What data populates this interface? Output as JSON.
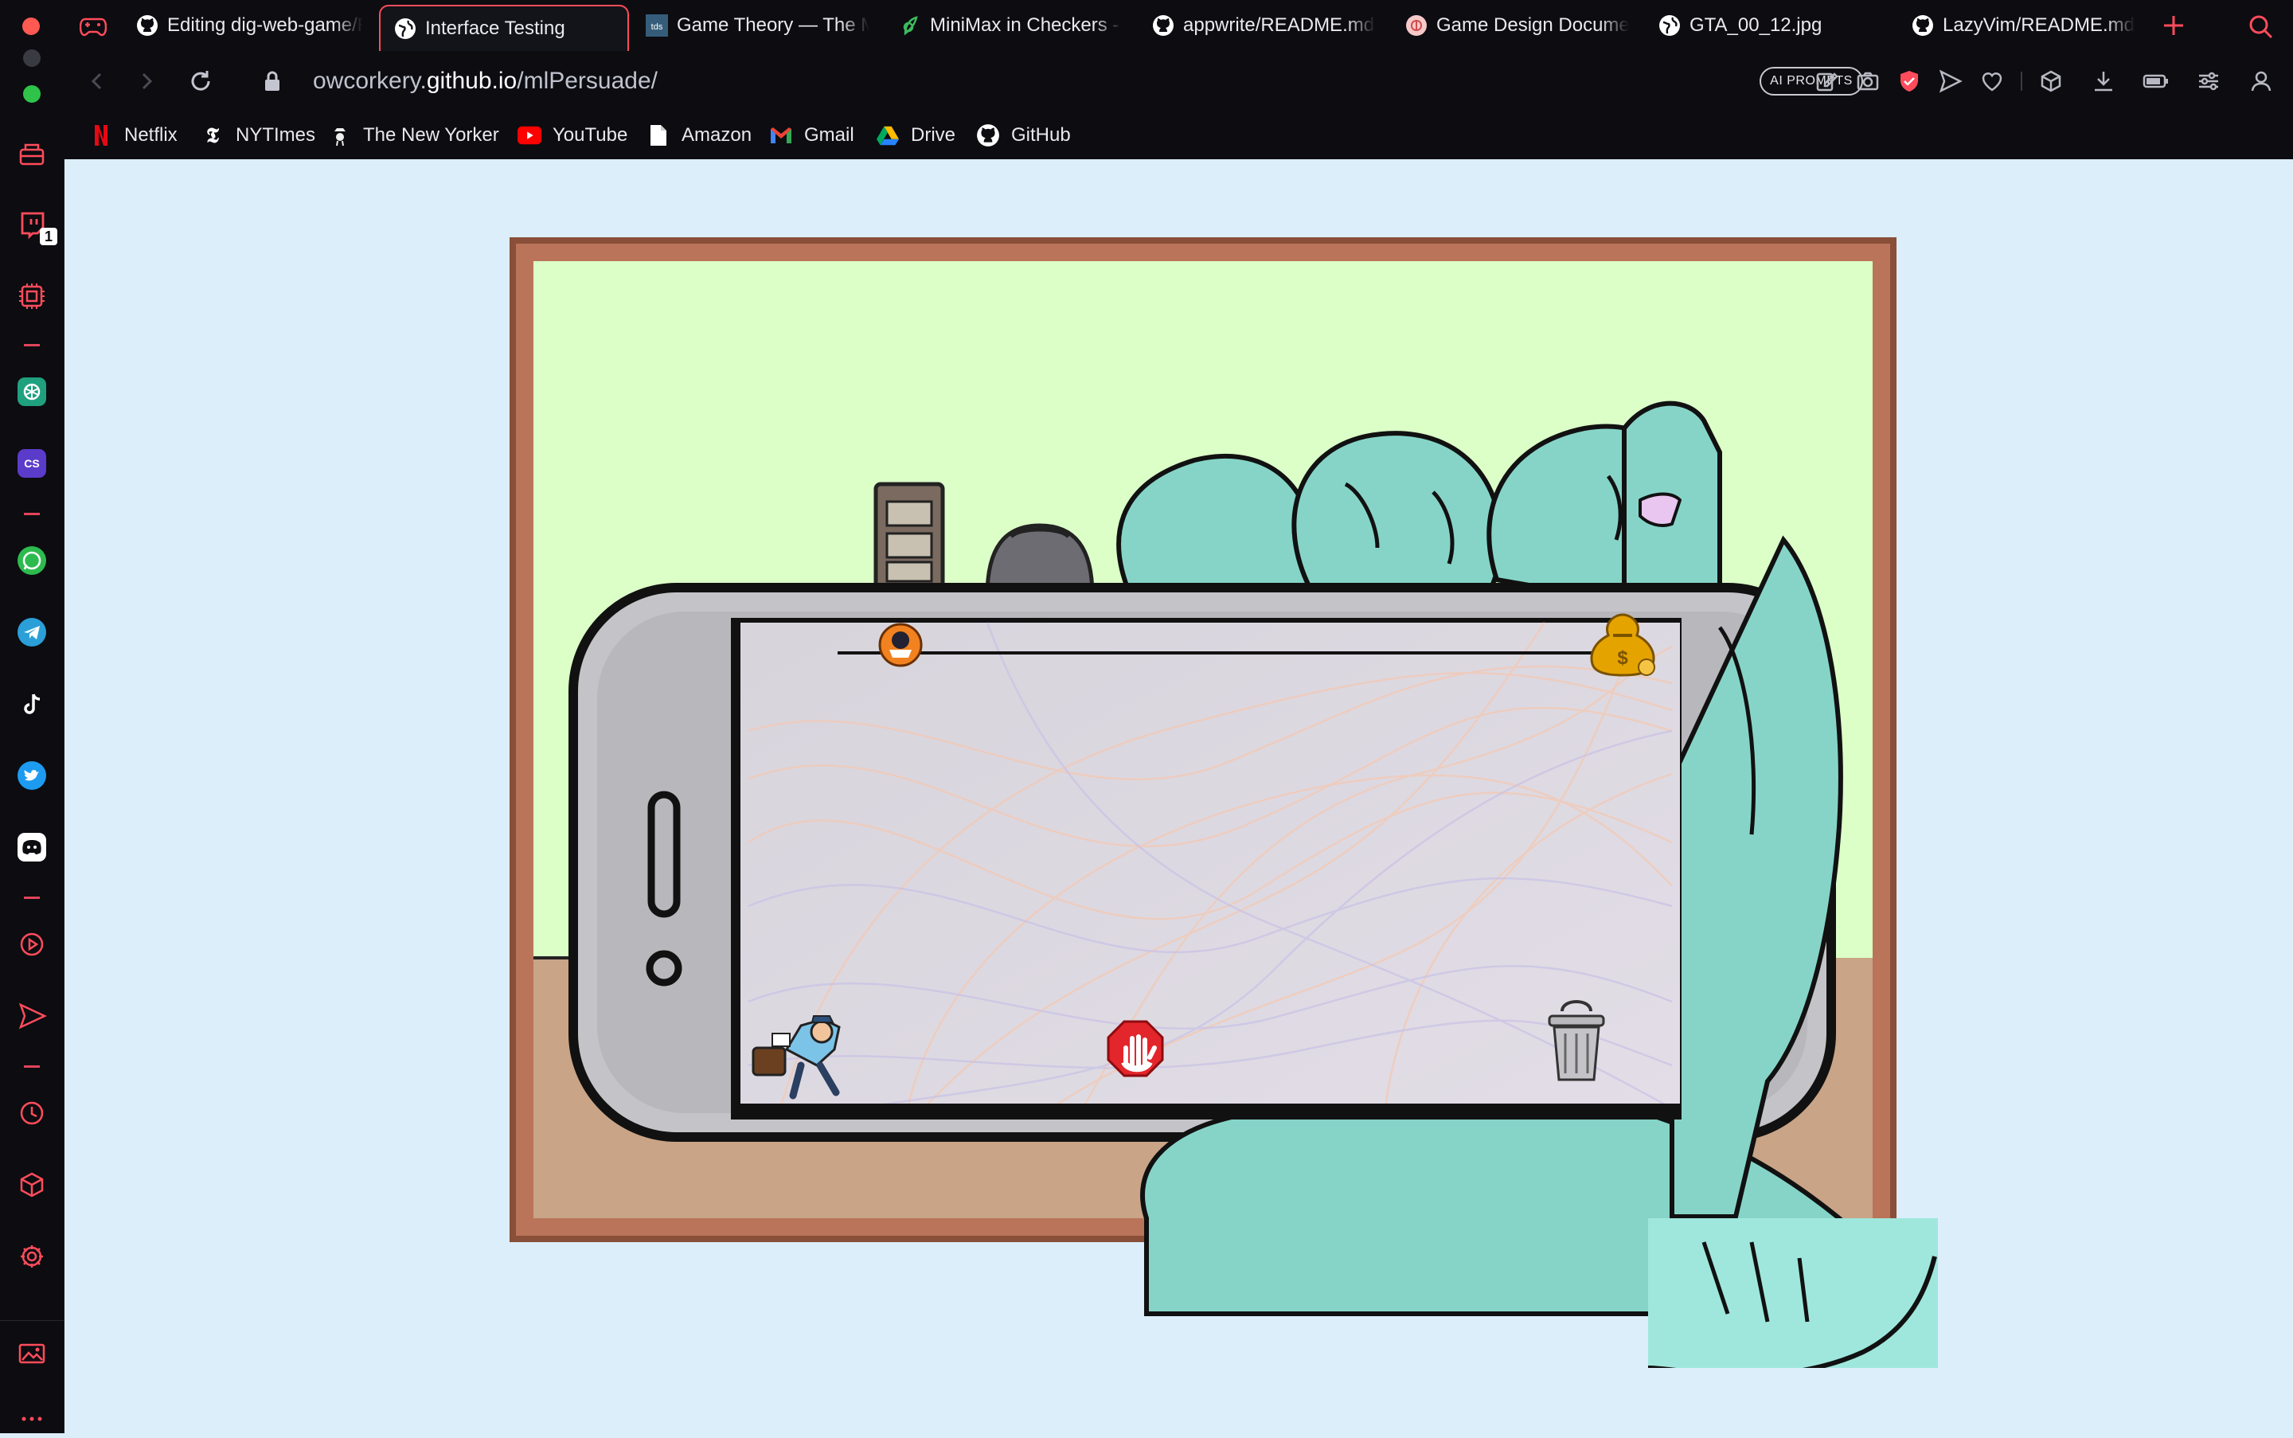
{
  "browser": {
    "tabs": [
      {
        "label": "Editing dig-web-game/README.md",
        "icon": "github-icon"
      },
      {
        "label": "Interface Testing",
        "icon": "globe-icon",
        "active": true
      },
      {
        "label": "Game Theory — The Minimax Algorithm",
        "icon": "tds-icon"
      },
      {
        "label": "MiniMax in Checkers - GeeksforGeeks",
        "icon": "leaf-icon"
      },
      {
        "label": "appwrite/README.md at master",
        "icon": "github-icon"
      },
      {
        "label": "Game Design Document",
        "icon": "brain-icon"
      },
      {
        "label": "GTA_00_12.jpg",
        "icon": "globe-icon"
      },
      {
        "label": "LazyVim/README.md at main",
        "icon": "github-icon"
      }
    ],
    "url": {
      "host_prefix": "owcorkery.",
      "host_main": "github.io",
      "path": "/mlPersuade/"
    },
    "ai_prompts_label": "AI PROMPTS",
    "bookmarks": [
      {
        "label": "Netflix",
        "icon": "netflix-icon"
      },
      {
        "label": "NYTImes",
        "icon": "nytimes-icon"
      },
      {
        "label": "The New Yorker",
        "icon": "new-yorker-icon"
      },
      {
        "label": "YouTube",
        "icon": "youtube-icon"
      },
      {
        "label": "Amazon",
        "icon": "document-icon"
      },
      {
        "label": "Gmail",
        "icon": "gmail-icon"
      },
      {
        "label": "Drive",
        "icon": "drive-icon"
      },
      {
        "label": "GitHub",
        "icon": "github-icon"
      }
    ],
    "sidebar_badge": "1",
    "colors": {
      "accent": "#ff4c5b",
      "chrome_bg": "#0c0c11",
      "page_bg": "#dbeefa"
    }
  },
  "game": {
    "progress_fraction": 0.08,
    "progress_start_icon": "player-token-icon",
    "progress_goal_icon": "money-bag-icon",
    "items": [
      "running-mailman-sprite",
      "stop-hand-icon",
      "trash-can-icon"
    ]
  }
}
